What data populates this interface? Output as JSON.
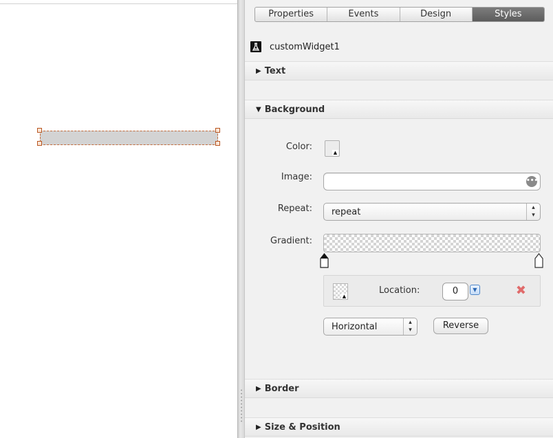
{
  "tabs": [
    {
      "label": "Properties",
      "active": false
    },
    {
      "label": "Events",
      "active": false
    },
    {
      "label": "Design",
      "active": false
    },
    {
      "label": "Styles",
      "active": true
    }
  ],
  "object": {
    "name": "customWidget1",
    "icon": "widget-flask-icon"
  },
  "sections": {
    "text": "Text",
    "background": "Background",
    "border": "Border",
    "size_position": "Size & Position"
  },
  "background": {
    "color_label": "Color:",
    "image_label": "Image:",
    "image_value": "",
    "repeat_label": "Repeat:",
    "repeat_value": "repeat",
    "gradient_label": "Gradient:",
    "location_label": "Location:",
    "location_value": "0",
    "orientation_value": "Horizontal",
    "reverse_label": "Reverse"
  },
  "colors": {
    "selection_dash": "#c26a3a",
    "widget_fill": "#d3d3d3",
    "active_tab": "#666666",
    "remove_icon": "#e06b6b"
  }
}
